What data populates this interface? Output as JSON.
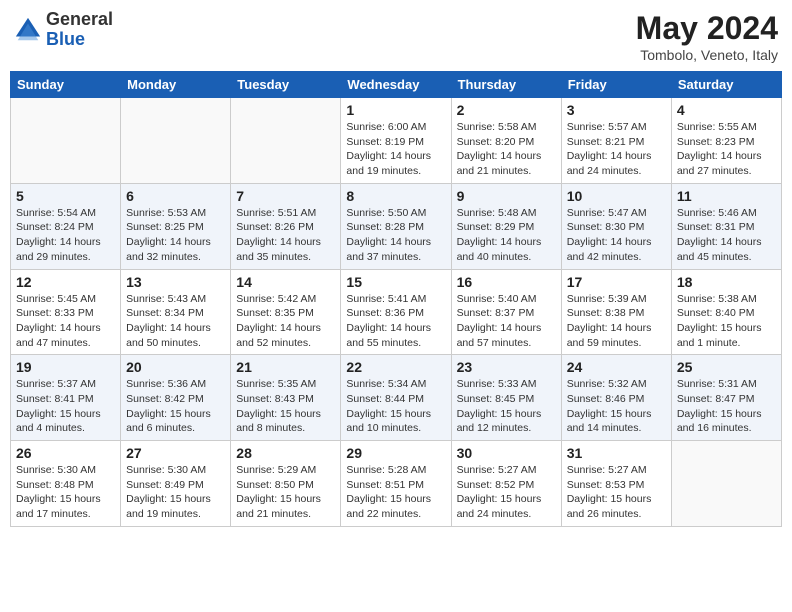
{
  "header": {
    "logo_general": "General",
    "logo_blue": "Blue",
    "month_title": "May 2024",
    "location": "Tombolo, Veneto, Italy"
  },
  "days_of_week": [
    "Sunday",
    "Monday",
    "Tuesday",
    "Wednesday",
    "Thursday",
    "Friday",
    "Saturday"
  ],
  "weeks": [
    [
      {
        "day": "",
        "info": ""
      },
      {
        "day": "",
        "info": ""
      },
      {
        "day": "",
        "info": ""
      },
      {
        "day": "1",
        "info": "Sunrise: 6:00 AM\nSunset: 8:19 PM\nDaylight: 14 hours\nand 19 minutes."
      },
      {
        "day": "2",
        "info": "Sunrise: 5:58 AM\nSunset: 8:20 PM\nDaylight: 14 hours\nand 21 minutes."
      },
      {
        "day": "3",
        "info": "Sunrise: 5:57 AM\nSunset: 8:21 PM\nDaylight: 14 hours\nand 24 minutes."
      },
      {
        "day": "4",
        "info": "Sunrise: 5:55 AM\nSunset: 8:23 PM\nDaylight: 14 hours\nand 27 minutes."
      }
    ],
    [
      {
        "day": "5",
        "info": "Sunrise: 5:54 AM\nSunset: 8:24 PM\nDaylight: 14 hours\nand 29 minutes."
      },
      {
        "day": "6",
        "info": "Sunrise: 5:53 AM\nSunset: 8:25 PM\nDaylight: 14 hours\nand 32 minutes."
      },
      {
        "day": "7",
        "info": "Sunrise: 5:51 AM\nSunset: 8:26 PM\nDaylight: 14 hours\nand 35 minutes."
      },
      {
        "day": "8",
        "info": "Sunrise: 5:50 AM\nSunset: 8:28 PM\nDaylight: 14 hours\nand 37 minutes."
      },
      {
        "day": "9",
        "info": "Sunrise: 5:48 AM\nSunset: 8:29 PM\nDaylight: 14 hours\nand 40 minutes."
      },
      {
        "day": "10",
        "info": "Sunrise: 5:47 AM\nSunset: 8:30 PM\nDaylight: 14 hours\nand 42 minutes."
      },
      {
        "day": "11",
        "info": "Sunrise: 5:46 AM\nSunset: 8:31 PM\nDaylight: 14 hours\nand 45 minutes."
      }
    ],
    [
      {
        "day": "12",
        "info": "Sunrise: 5:45 AM\nSunset: 8:33 PM\nDaylight: 14 hours\nand 47 minutes."
      },
      {
        "day": "13",
        "info": "Sunrise: 5:43 AM\nSunset: 8:34 PM\nDaylight: 14 hours\nand 50 minutes."
      },
      {
        "day": "14",
        "info": "Sunrise: 5:42 AM\nSunset: 8:35 PM\nDaylight: 14 hours\nand 52 minutes."
      },
      {
        "day": "15",
        "info": "Sunrise: 5:41 AM\nSunset: 8:36 PM\nDaylight: 14 hours\nand 55 minutes."
      },
      {
        "day": "16",
        "info": "Sunrise: 5:40 AM\nSunset: 8:37 PM\nDaylight: 14 hours\nand 57 minutes."
      },
      {
        "day": "17",
        "info": "Sunrise: 5:39 AM\nSunset: 8:38 PM\nDaylight: 14 hours\nand 59 minutes."
      },
      {
        "day": "18",
        "info": "Sunrise: 5:38 AM\nSunset: 8:40 PM\nDaylight: 15 hours\nand 1 minute."
      }
    ],
    [
      {
        "day": "19",
        "info": "Sunrise: 5:37 AM\nSunset: 8:41 PM\nDaylight: 15 hours\nand 4 minutes."
      },
      {
        "day": "20",
        "info": "Sunrise: 5:36 AM\nSunset: 8:42 PM\nDaylight: 15 hours\nand 6 minutes."
      },
      {
        "day": "21",
        "info": "Sunrise: 5:35 AM\nSunset: 8:43 PM\nDaylight: 15 hours\nand 8 minutes."
      },
      {
        "day": "22",
        "info": "Sunrise: 5:34 AM\nSunset: 8:44 PM\nDaylight: 15 hours\nand 10 minutes."
      },
      {
        "day": "23",
        "info": "Sunrise: 5:33 AM\nSunset: 8:45 PM\nDaylight: 15 hours\nand 12 minutes."
      },
      {
        "day": "24",
        "info": "Sunrise: 5:32 AM\nSunset: 8:46 PM\nDaylight: 15 hours\nand 14 minutes."
      },
      {
        "day": "25",
        "info": "Sunrise: 5:31 AM\nSunset: 8:47 PM\nDaylight: 15 hours\nand 16 minutes."
      }
    ],
    [
      {
        "day": "26",
        "info": "Sunrise: 5:30 AM\nSunset: 8:48 PM\nDaylight: 15 hours\nand 17 minutes."
      },
      {
        "day": "27",
        "info": "Sunrise: 5:30 AM\nSunset: 8:49 PM\nDaylight: 15 hours\nand 19 minutes."
      },
      {
        "day": "28",
        "info": "Sunrise: 5:29 AM\nSunset: 8:50 PM\nDaylight: 15 hours\nand 21 minutes."
      },
      {
        "day": "29",
        "info": "Sunrise: 5:28 AM\nSunset: 8:51 PM\nDaylight: 15 hours\nand 22 minutes."
      },
      {
        "day": "30",
        "info": "Sunrise: 5:27 AM\nSunset: 8:52 PM\nDaylight: 15 hours\nand 24 minutes."
      },
      {
        "day": "31",
        "info": "Sunrise: 5:27 AM\nSunset: 8:53 PM\nDaylight: 15 hours\nand 26 minutes."
      },
      {
        "day": "",
        "info": ""
      }
    ]
  ]
}
